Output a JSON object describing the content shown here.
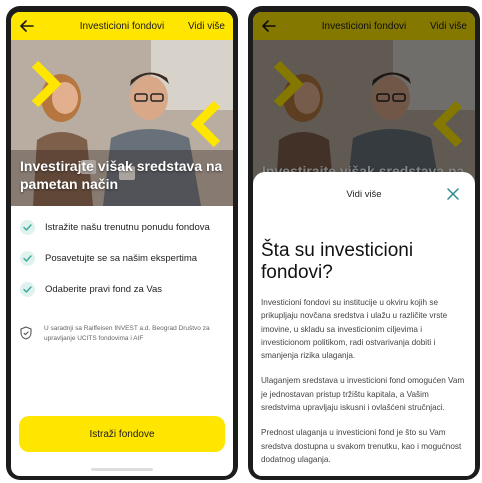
{
  "header": {
    "title": "Investicioni fondovi",
    "more_label": "Vidi više"
  },
  "hero": {
    "title": "Investirajte višak sredstava na pametan način"
  },
  "features": [
    {
      "label": "Istražite našu trenutnu ponudu fondova"
    },
    {
      "label": "Posavetujte se sa našim ekspertima"
    },
    {
      "label": "Odaberite pravi fond za Vas"
    }
  ],
  "note": {
    "text": "U saradnji sa Raiffeisen INVEST a.d. Beograd Društvo za upravljanje UCITS fondovima i AIF"
  },
  "cta": {
    "label": "Istraži fondove"
  },
  "sheet": {
    "title": "Vidi više",
    "heading": "Šta su investicioni fondovi?",
    "paragraphs": [
      "Investicioni fondovi su institucije u okviru kojih se prikupljaju novčana sredstva i ulažu u različite vrste imovine, u skladu sa investicionim ciljevima i investicionom politikom, radi ostvarivanja dobiti i smanjenja rizika ulaganja.",
      "Ulaganjem sredstava u investicioni fond omogućen Vam je jednostavan pristup tržištu kapitala, a Vašim sredstvima upravljaju iskusni i ovlašćeni stručnjaci.",
      "Prednost ulaganja u investicioni fond je što su Vam sredstva dostupna u svakom trenutku, kao i mogućnost dodatnog ulaganja."
    ]
  },
  "colors": {
    "brand_yellow": "#ffe600",
    "check_teal": "#3aa89a",
    "close_teal": "#2b8c8c"
  }
}
